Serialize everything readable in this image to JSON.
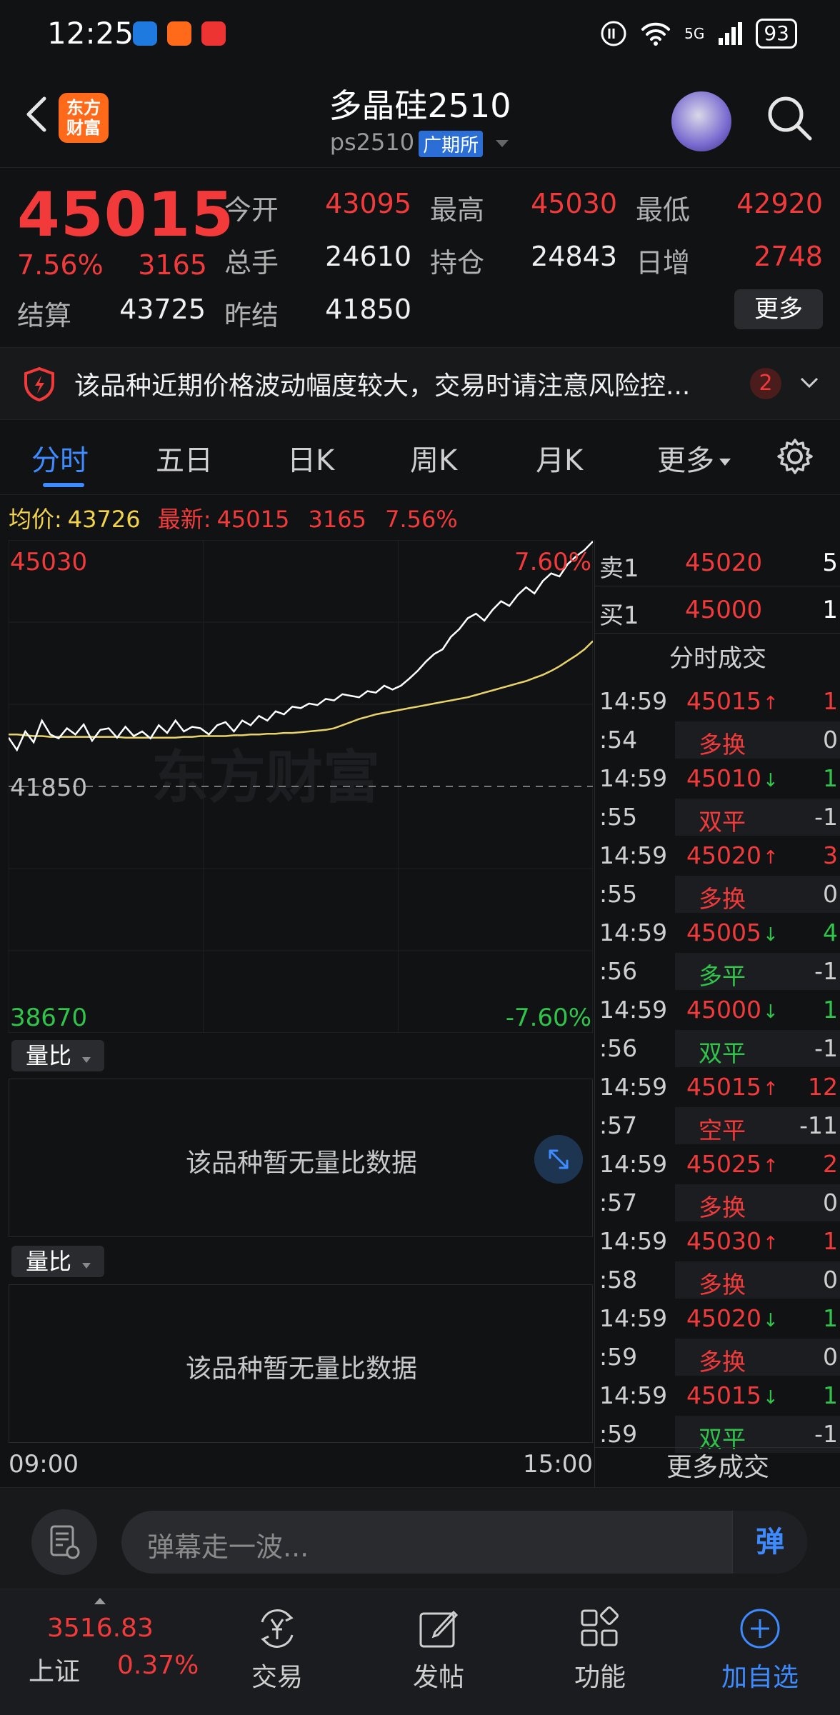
{
  "status_bar": {
    "time": "12:25",
    "battery": "93",
    "network": "5G"
  },
  "header": {
    "title": "多晶硅2510",
    "code": "ps2510",
    "exchange": "广期所",
    "logo_text": "东方财富"
  },
  "quote": {
    "last": "45015",
    "pct": "7.56%",
    "change": "3165",
    "fields": [
      {
        "label": "今开",
        "value": "43095",
        "color": "red"
      },
      {
        "label": "最高",
        "value": "45030",
        "color": "red"
      },
      {
        "label": "最低",
        "value": "42920",
        "color": "red"
      },
      {
        "label": "总手",
        "value": "24610",
        "color": "white"
      },
      {
        "label": "持仓",
        "value": "24843",
        "color": "white"
      },
      {
        "label": "日增",
        "value": "2748",
        "color": "red"
      },
      {
        "label": "结算",
        "value": "43725",
        "color": "white"
      },
      {
        "label": "昨结",
        "value": "41850",
        "color": "white"
      }
    ],
    "more_label": "更多"
  },
  "risk": {
    "text": "该品种近期价格波动幅度较大，交易时请注意风险控...",
    "count": "2"
  },
  "tabs": [
    "分时",
    "五日",
    "日K",
    "周K",
    "月K",
    "更多"
  ],
  "info_line": {
    "avg_label": "均价:",
    "avg": "43726",
    "latest_label": "最新:",
    "latest": "45015",
    "change": "3165",
    "pct": "7.56%"
  },
  "chart_data": {
    "type": "line",
    "title": "",
    "xlabel": "",
    "ylabel": "",
    "x_ticks": [
      "09:00",
      "15:00"
    ],
    "y_top": "45030",
    "y_mid": "41850",
    "y_bottom": "38670",
    "pct_top": "7.60%",
    "pct_bottom": "-7.60%",
    "ylim": [
      38670,
      45030
    ],
    "watermark": "东方财富",
    "series": [
      {
        "name": "",
        "color": "#ffffff",
        "values": [
          42480,
          42320,
          42560,
          42420,
          42700,
          42520,
          42470,
          42600,
          42520,
          42650,
          42440,
          42580,
          42600,
          42480,
          42620,
          42500,
          42560,
          42470,
          42640,
          42540,
          42700,
          42560,
          42620,
          42600,
          42520,
          42640,
          42680,
          42560,
          42700,
          42640,
          42760,
          42700,
          42820,
          42780,
          42880,
          42860,
          42920,
          42900,
          42980,
          42960,
          43040,
          43020,
          43000,
          43080,
          43060,
          43150,
          43100,
          43150,
          43240,
          43340,
          43460,
          43560,
          43620,
          43780,
          43880,
          44020,
          44080,
          43990,
          44130,
          44240,
          44180,
          44320,
          44420,
          44340,
          44500,
          44600,
          44560,
          44720,
          44820,
          44900,
          45015
        ]
      },
      {
        "name": "",
        "color": "#e8d36a",
        "values": [
          42520,
          42520,
          42510,
          42500,
          42500,
          42490,
          42490,
          42490,
          42490,
          42490,
          42490,
          42490,
          42490,
          42490,
          42480,
          42480,
          42480,
          42480,
          42480,
          42480,
          42480,
          42490,
          42490,
          42500,
          42500,
          42500,
          42500,
          42510,
          42510,
          42520,
          42520,
          42530,
          42530,
          42540,
          42540,
          42550,
          42560,
          42570,
          42580,
          42600,
          42640,
          42680,
          42720,
          42750,
          42780,
          42800,
          42820,
          42840,
          42860,
          42880,
          42900,
          42920,
          42940,
          42960,
          42980,
          43000,
          43030,
          43060,
          43090,
          43120,
          43150,
          43180,
          43210,
          43250,
          43290,
          43340,
          43400,
          43470,
          43540,
          43620,
          43726
        ]
      }
    ]
  },
  "vol_panels": [
    {
      "label": "量比",
      "empty_text": "该品种暂无量比数据"
    },
    {
      "label": "量比",
      "empty_text": "该品种暂无量比数据"
    }
  ],
  "orderbook": [
    {
      "label": "卖1",
      "price": "45020",
      "qty": "5"
    },
    {
      "label": "买1",
      "price": "45000",
      "qty": "1"
    }
  ],
  "trades_title": "分时成交",
  "trades": [
    {
      "time": "14:59",
      "price": "45015",
      "dir": "up",
      "qty": "1",
      "sub": ":54",
      "type": "多换",
      "type_color": "red",
      "type_qty": "0"
    },
    {
      "time": "14:59",
      "price": "45010",
      "dir": "down",
      "qty": "1",
      "sub": ":55",
      "type": "双平",
      "type_color": "red",
      "type_qty": "-1"
    },
    {
      "time": "14:59",
      "price": "45020",
      "dir": "up",
      "qty": "3",
      "sub": ":55",
      "type": "多换",
      "type_color": "red",
      "type_qty": "0"
    },
    {
      "time": "14:59",
      "price": "45005",
      "dir": "down",
      "qty": "4",
      "sub": ":56",
      "type": "多平",
      "type_color": "green",
      "type_qty": "-1"
    },
    {
      "time": "14:59",
      "price": "45000",
      "dir": "down",
      "qty": "1",
      "sub": ":56",
      "type": "双平",
      "type_color": "green",
      "type_qty": "-1"
    },
    {
      "time": "14:59",
      "price": "45015",
      "dir": "up",
      "qty": "12",
      "sub": ":57",
      "type": "空平",
      "type_color": "red",
      "type_qty": "-11"
    },
    {
      "time": "14:59",
      "price": "45025",
      "dir": "up",
      "qty": "2",
      "sub": ":57",
      "type": "多换",
      "type_color": "red",
      "type_qty": "0"
    },
    {
      "time": "14:59",
      "price": "45030",
      "dir": "up",
      "qty": "1",
      "sub": ":58",
      "type": "多换",
      "type_color": "red",
      "type_qty": "0"
    },
    {
      "time": "14:59",
      "price": "45020",
      "dir": "down",
      "qty": "1",
      "sub": ":59",
      "type": "多换",
      "type_color": "red",
      "type_qty": "0"
    },
    {
      "time": "14:59",
      "price": "45015",
      "dir": "down",
      "qty": "1",
      "sub": ":59",
      "type": "双平",
      "type_color": "green",
      "type_qty": "-1"
    }
  ],
  "more_trades": "更多成交",
  "comment": {
    "placeholder": "弹幕走一波...",
    "button": "弹"
  },
  "index": {
    "value": "3516.83",
    "name": "上证",
    "pct": "0.37%"
  },
  "nav": [
    {
      "label": "交易",
      "icon": "trade-icon"
    },
    {
      "label": "发帖",
      "icon": "post-icon"
    },
    {
      "label": "功能",
      "icon": "apps-icon"
    },
    {
      "label": "加自选",
      "icon": "add-watchlist-icon"
    }
  ]
}
